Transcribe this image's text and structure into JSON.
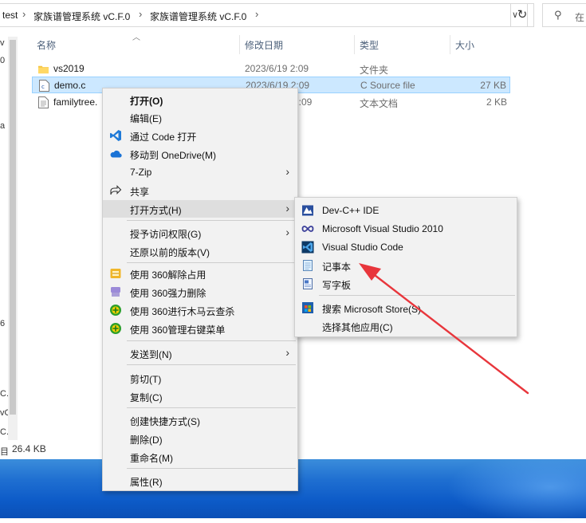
{
  "address": {
    "crumbs": [
      "test",
      "家族谱管理系统 vC.F.0",
      "家族谱管理系统 vC.F.0"
    ],
    "separator": "›",
    "dropdown_glyph": "∨"
  },
  "refresh_glyph": "↻",
  "search": {
    "placeholder": "在",
    "icon": "search-icon"
  },
  "nav_fragments": [
    "v",
    "0",
    "a",
    "6",
    "C.",
    "vC",
    "C.",
    "目"
  ],
  "columns": {
    "name": "名称",
    "date": "修改日期",
    "type": "类型",
    "size": "大小"
  },
  "files": [
    {
      "name": "vs2019",
      "date": "2023/6/19 2:09",
      "type": "文件夹",
      "size": "",
      "icon": "folder-icon"
    },
    {
      "name": "demo.c",
      "date": "2023/6/19 2:09",
      "type": "C Source file",
      "size": "27 KB",
      "icon": "c-file-icon"
    },
    {
      "name": "familytree.",
      "date": "2:09",
      "type": "文本文档",
      "size": "2 KB",
      "icon": "text-file-icon"
    }
  ],
  "status": {
    "size": "26.4 KB"
  },
  "context_menu": {
    "open": "打开(O)",
    "edit": "编辑(E)",
    "open_with_code": "通过 Code 打开",
    "move_onedrive": "移动到 OneDrive(M)",
    "sevenzip": "7-Zip",
    "share": "共享",
    "open_with": "打开方式(H)",
    "grant_access": "授予访问权限(G)",
    "restore": "还原以前的版本(V)",
    "use360_unlock": "使用 360解除占用",
    "use360_delete": "使用 360强力删除",
    "use360_scan": "使用 360进行木马云查杀",
    "use360_menu": "使用 360管理右键菜单",
    "send_to": "发送到(N)",
    "cut": "剪切(T)",
    "copy": "复制(C)",
    "create_shortcut": "创建快捷方式(S)",
    "delete": "删除(D)",
    "rename": "重命名(M)",
    "properties": "属性(R)"
  },
  "open_with_menu": {
    "devcpp": "Dev-C++ IDE",
    "vs2010": "Microsoft Visual Studio 2010",
    "vscode": "Visual Studio Code",
    "notepad": "记事本",
    "wordpad": "写字板",
    "store": "搜索 Microsoft Store(S)",
    "choose": "选择其他应用(C)"
  },
  "colors": {
    "selection": "#cce8ff",
    "menu_bg": "#f2f2f2",
    "annotation_arrow": "#e8363c",
    "desktop": "#1f6fd1"
  }
}
